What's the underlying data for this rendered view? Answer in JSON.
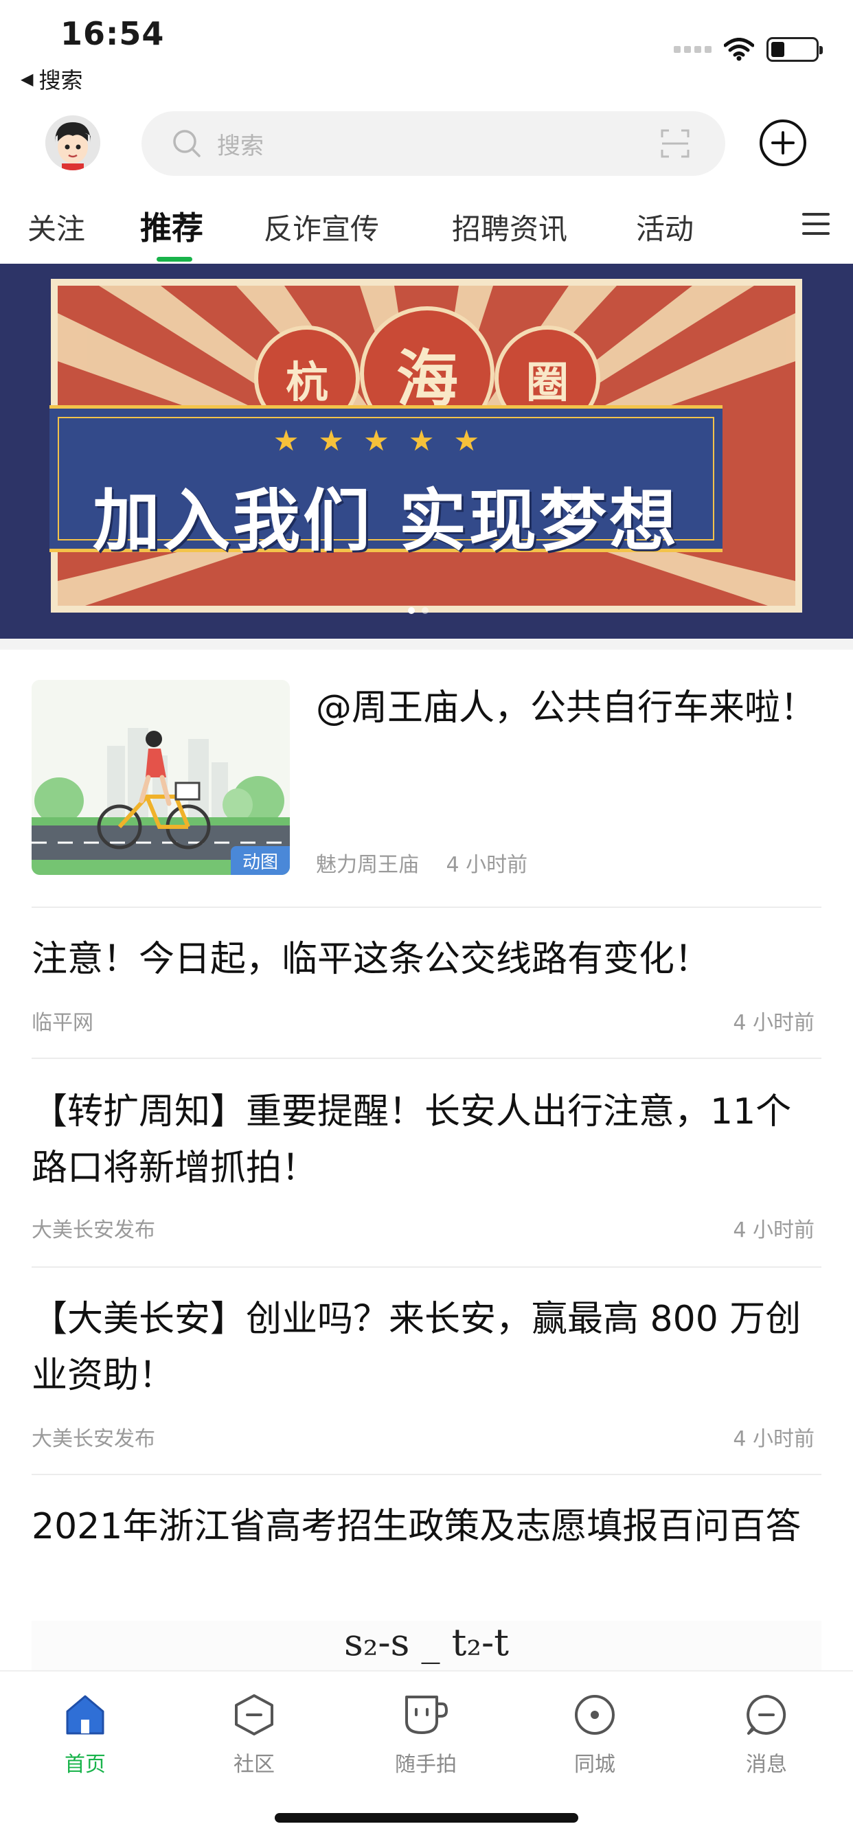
{
  "status_bar": {
    "time": "16:54",
    "back_app": "搜索"
  },
  "header": {
    "search_placeholder": "搜索"
  },
  "tabs": [
    {
      "label": "关注"
    },
    {
      "label": "推荐"
    },
    {
      "label": "反诈宣传"
    },
    {
      "label": "招聘资讯"
    },
    {
      "label": "活动"
    }
  ],
  "banner": {
    "seal_chars": [
      "杭",
      "海",
      "圈"
    ],
    "slogan": "加入我们 实现梦想",
    "stars": "★★★★★"
  },
  "feed": [
    {
      "title": "@周王庙人，公共自行车来啦！",
      "source": "魅力周王庙",
      "time": "4 小时前",
      "badge": "动图"
    },
    {
      "title": "注意！今日起，临平这条公交线路有变化！",
      "source": "临平网",
      "time": "4 小时前"
    },
    {
      "title": "【转扩周知】重要提醒！长安人出行注意，11个路口将新增抓拍！",
      "source": "大美长安发布",
      "time": "4 小时前"
    },
    {
      "title": "【大美长安】创业吗？来长安，赢最高 800 万创业资助！",
      "source": "大美长安发布",
      "time": "4 小时前"
    },
    {
      "title": "2021年浙江省高考招生政策及志愿填报百问百答"
    }
  ],
  "formula_preview": "s₂-s  _  t₂-t",
  "bottom_nav": [
    {
      "label": "首页",
      "icon": "home-icon"
    },
    {
      "label": "社区",
      "icon": "community-icon"
    },
    {
      "label": "随手拍",
      "icon": "cup-icon"
    },
    {
      "label": "同城",
      "icon": "location-icon"
    },
    {
      "label": "消息",
      "icon": "message-icon"
    }
  ],
  "colors": {
    "accent": "#18b34a",
    "banner_bg": "#2d3467",
    "banner_red": "#c5523f",
    "banner_blue": "#334a8a",
    "star_gold": "#f6c13a"
  }
}
